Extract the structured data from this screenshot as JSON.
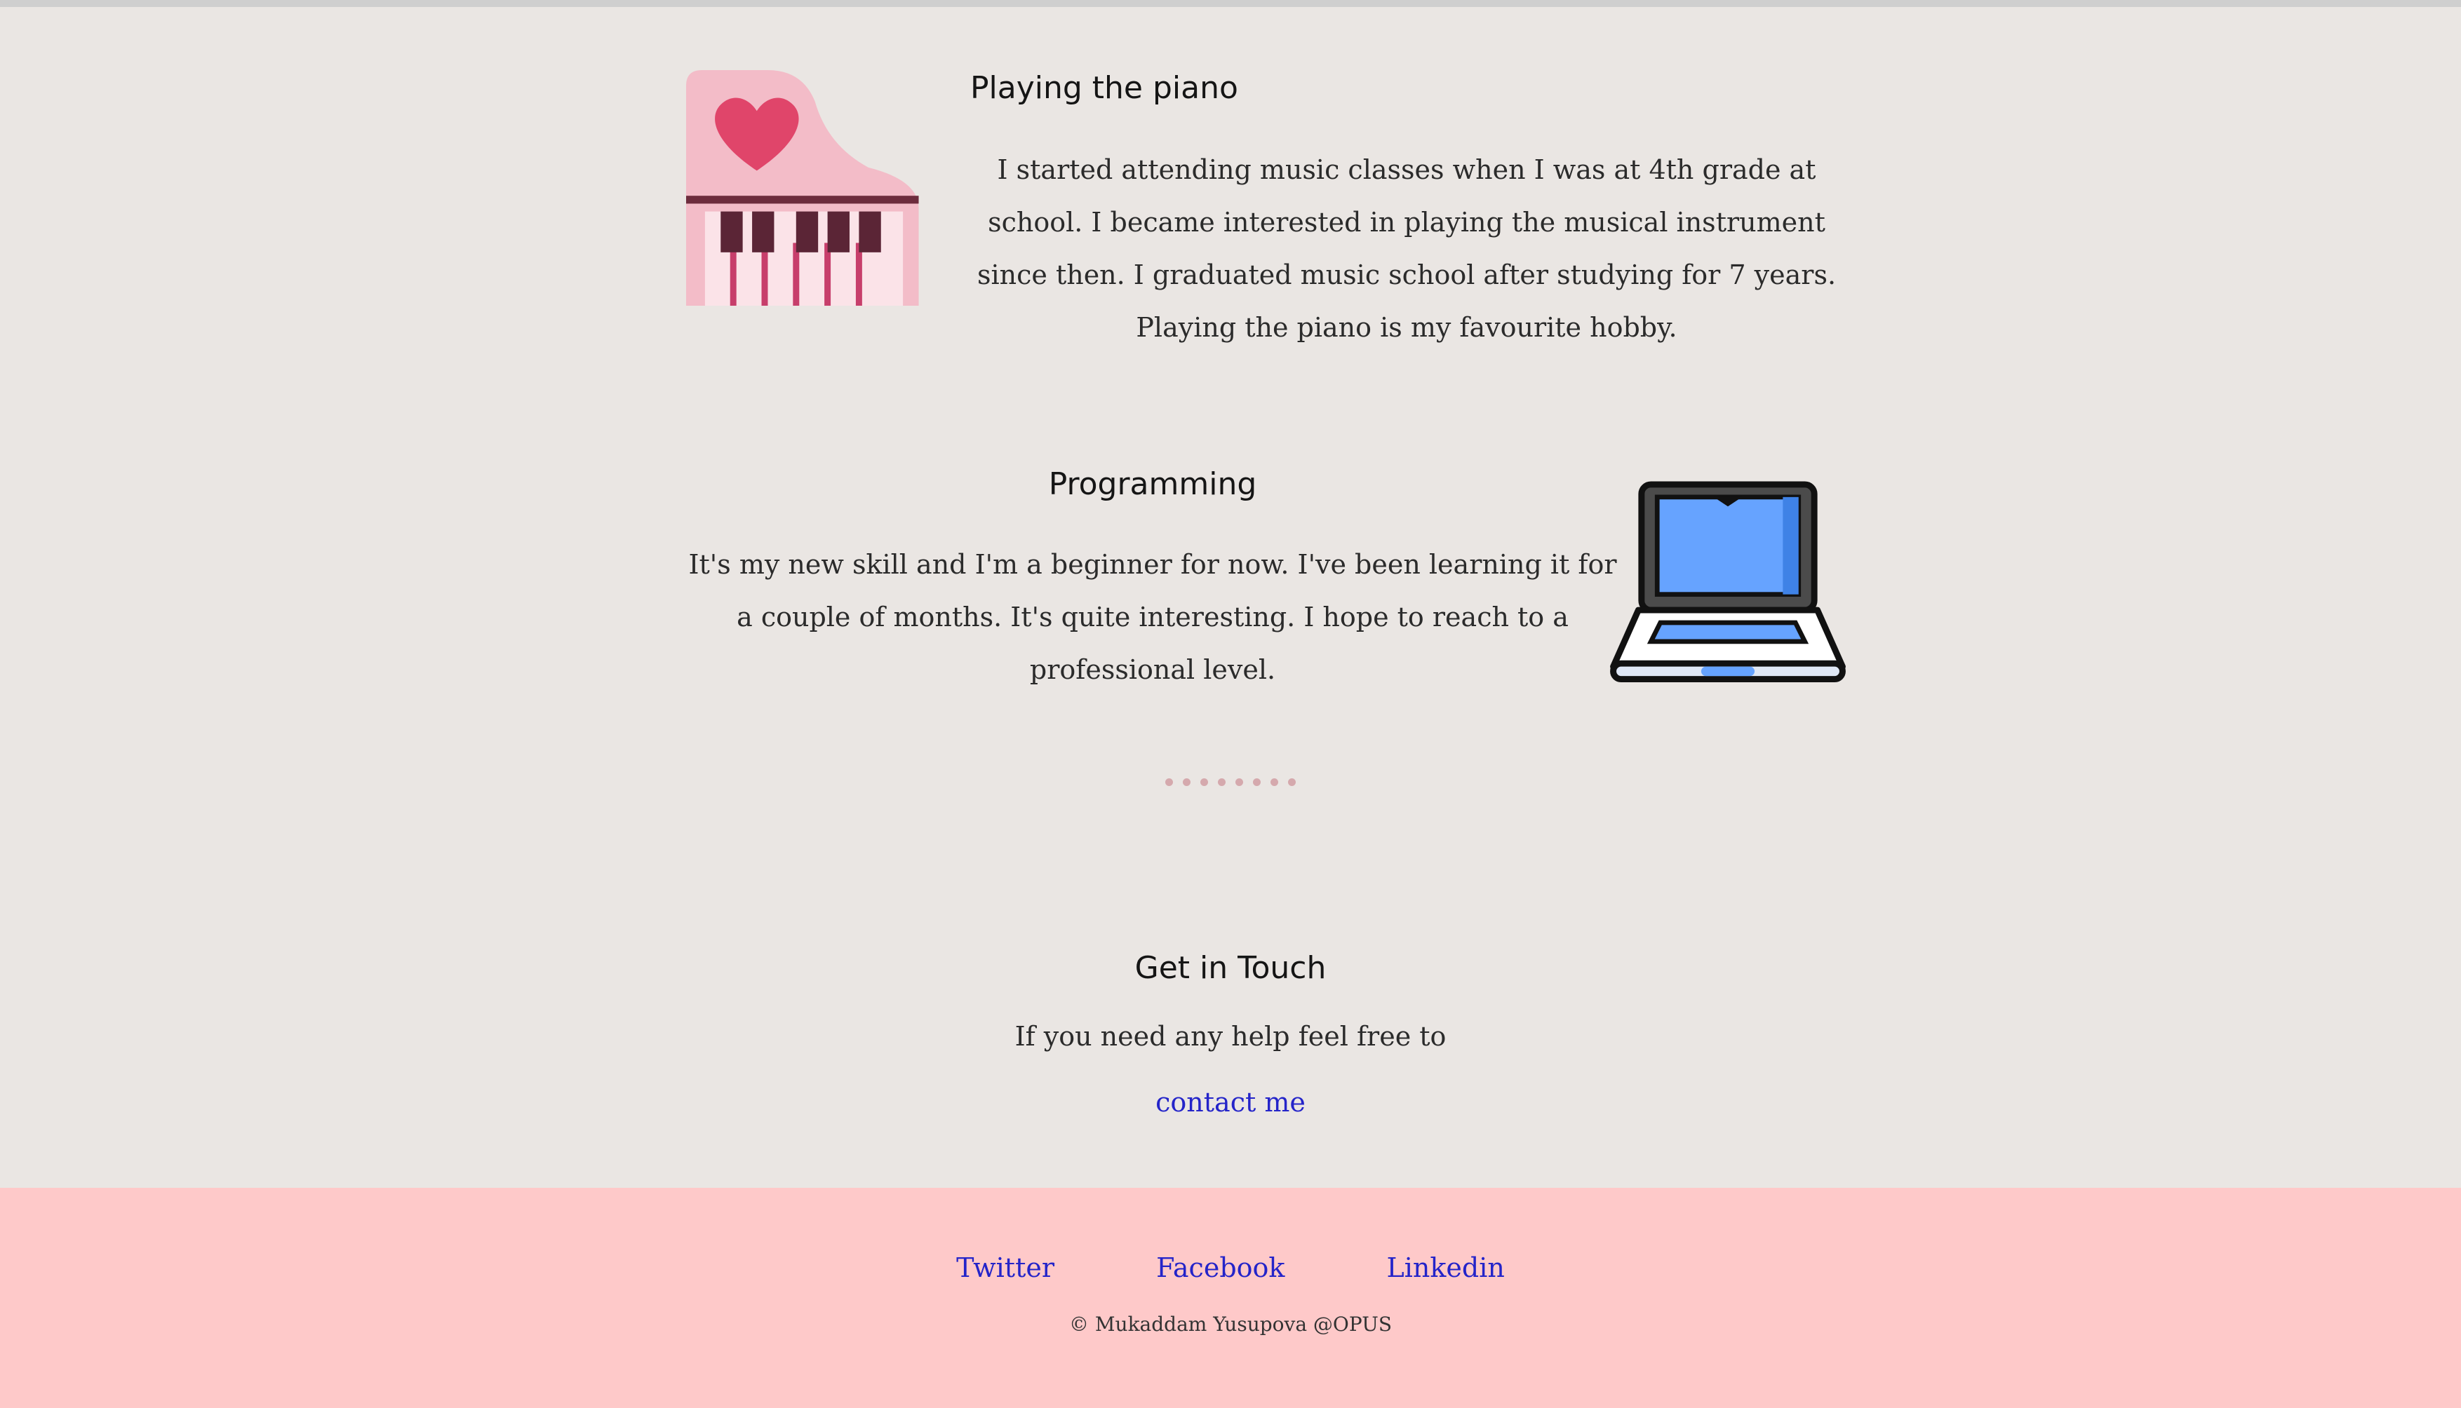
{
  "hobbies": {
    "piano": {
      "title": "Playing the piano",
      "text": "I started attending music classes when I was at 4th grade at school. I became interested in playing the musical instrument since then. I graduated music school after studying for 7 years. Playing the piano is my favourite hobby.",
      "icon": "piano-heart-icon"
    },
    "programming": {
      "title": "Programming",
      "text": "It's my new skill and I'm a beginner for now. I've been learning it for a couple of months. It's quite interesting. I hope to reach to a professional level.",
      "icon": "laptop-icon"
    }
  },
  "divider": {
    "dot_color": "#d5a9ad",
    "dot_count": 8
  },
  "contact": {
    "title": "Get in Touch",
    "text": "If you need any help feel free to",
    "link_label": "contact me"
  },
  "footer": {
    "background": "#fec9c9",
    "links": [
      "Twitter",
      "Facebook",
      "Linkedin"
    ],
    "copyright": "© Mukaddam Yusupova @OPUS"
  },
  "colors": {
    "page_background": "#eae6e3",
    "link": "#2424c9"
  }
}
